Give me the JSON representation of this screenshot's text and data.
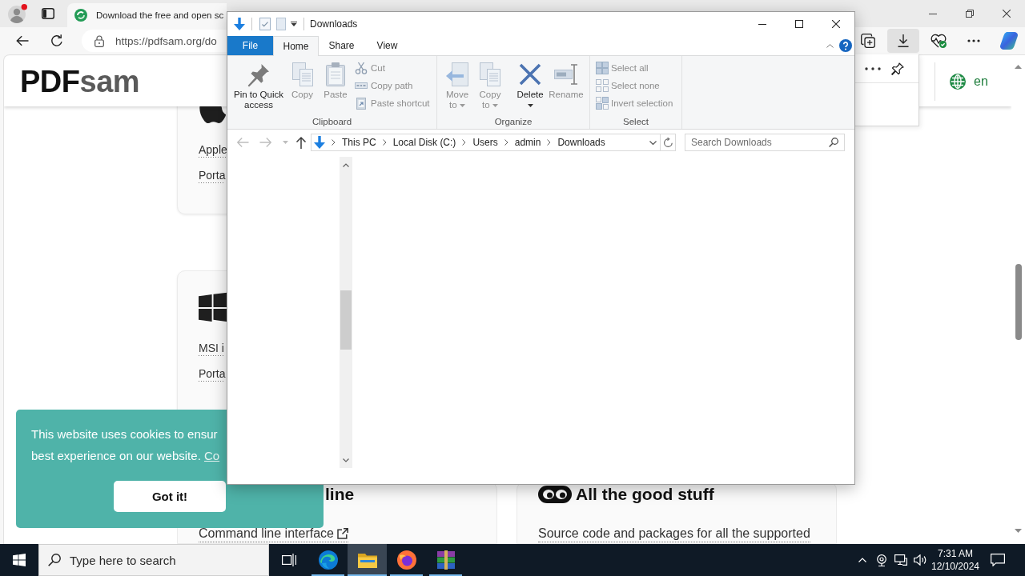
{
  "browser": {
    "tab": {
      "title": "Download the free and open sc",
      "selected": true
    },
    "address_bar": {
      "url": "https://pdfsam.org/do"
    },
    "toolbar_buttons": [
      {
        "kind": "collections",
        "selected": false
      },
      {
        "kind": "downloads",
        "selected": true
      },
      {
        "kind": "essentials",
        "selected": false
      },
      {
        "kind": "more",
        "selected": false
      },
      {
        "kind": "copilot",
        "selected": false
      }
    ]
  },
  "page": {
    "logo": {
      "dark": "PDF",
      "light": "sam"
    },
    "language": "en",
    "cards": [
      {
        "kind": "apple",
        "links": [
          "Apple",
          "Porta"
        ]
      },
      {
        "kind": "windows",
        "links": [
          "MSI i",
          "Porta"
        ]
      }
    ],
    "feature_cards": [
      {
        "kind": "command_line",
        "heading": "line",
        "link": "Command line interface",
        "external": true
      },
      {
        "kind": "good_stuff",
        "heading": "All the good stuff",
        "link": "Source code and packages for all the supported",
        "external": false
      }
    ],
    "cookie_banner": {
      "message_lines": [
        "This website uses cookies to ensur",
        "best experience on our website."
      ],
      "link": "Co",
      "button": "Got it!"
    }
  },
  "explorer": {
    "title": "Downloads",
    "ribbon_tabs": [
      {
        "label": "File",
        "kind": "backstage",
        "selected": false
      },
      {
        "label": "Home",
        "kind": "tab",
        "selected": true
      },
      {
        "label": "Share",
        "kind": "tab",
        "selected": false
      },
      {
        "label": "View",
        "kind": "tab",
        "selected": false
      }
    ],
    "ribbon_groups": [
      {
        "label": "Clipboard",
        "large": [
          {
            "kind": "pin",
            "label": "Pin to Quick access",
            "disabled": false,
            "dropdown": false
          },
          {
            "kind": "copy",
            "label": "Copy",
            "disabled": true,
            "dropdown": false
          },
          {
            "kind": "paste",
            "label": "Paste",
            "disabled": true,
            "dropdown": false
          }
        ],
        "small": [
          {
            "kind": "cut",
            "label": "Cut",
            "disabled": true
          },
          {
            "kind": "copy_path",
            "label": "Copy path",
            "disabled": true
          },
          {
            "kind": "paste_shortcut",
            "label": "Paste shortcut",
            "disabled": true
          }
        ]
      },
      {
        "label": "Organize",
        "large": [
          {
            "kind": "move_to",
            "label": "Move to",
            "disabled": true,
            "dropdown": true
          },
          {
            "kind": "copy_to",
            "label": "Copy to",
            "disabled": true,
            "dropdown": true
          },
          {
            "kind": "delete",
            "label": "Delete",
            "disabled": false,
            "dropdown": true
          },
          {
            "kind": "rename",
            "label": "Rename",
            "disabled": true,
            "dropdown": false
          }
        ]
      },
      {
        "label": "Select",
        "small": [
          {
            "kind": "select_all",
            "label": "Select all",
            "disabled": true
          },
          {
            "kind": "select_none",
            "label": "Select none",
            "disabled": true
          },
          {
            "kind": "invert_selection",
            "label": "Invert selection",
            "disabled": true
          }
        ]
      }
    ],
    "nav_buttons": [
      {
        "kind": "back",
        "disabled": true
      },
      {
        "kind": "forward",
        "disabled": true
      },
      {
        "kind": "recent",
        "disabled": true
      },
      {
        "kind": "up",
        "disabled": false
      }
    ],
    "breadcrumb": [
      "This PC",
      "Local Disk (C:)",
      "Users",
      "admin",
      "Downloads"
    ],
    "search": {
      "placeholder": "Search Downloads"
    }
  },
  "taskbar": {
    "search": {
      "placeholder": "Type here to search"
    },
    "apps": [
      {
        "kind": "edge",
        "running": true,
        "selected": false
      },
      {
        "kind": "explorer",
        "running": true,
        "selected": true
      },
      {
        "kind": "firefox",
        "running": true,
        "selected": false
      },
      {
        "kind": "winrar",
        "running": true,
        "selected": false
      }
    ],
    "clock": {
      "time": "7:31 AM",
      "date": "12/10/2024"
    }
  }
}
